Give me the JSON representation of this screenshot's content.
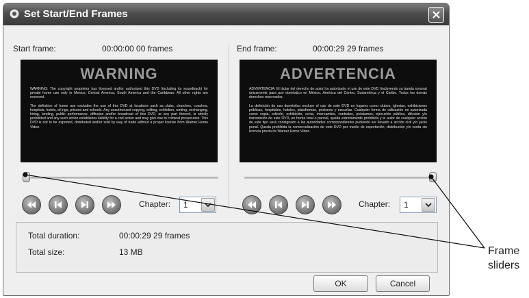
{
  "window": {
    "title": "Set Start/End Frames"
  },
  "start": {
    "label": "Start frame:",
    "value": "00:00:00 00 frames",
    "preview_heading": "WARNING",
    "preview_text_1": "WARNING: The copyright proprietor has licensed and/or authorized this DVD (including its soundtrack) for private home use only in Mexico, Central America, South America and the Caribbean. All other rights are reserved.",
    "preview_text_2": "The definition of home use excludes the use of this DVD at locations such as clubs, churches, coaches, hospitals, hotels, oil rigs, prisons and schools. Any unauthorized copying, editing, exhibition, renting, exchanging, hiring, lending, public performance, diffusion and/or broadcast of this DVD, or any part thereof, is strictly prohibited and any such action establishes liability for a civil action and may give rise to criminal prosecution. This DVD is not to be exported, distributed and/or sold by way of trade without a proper license from Warner Home Video.",
    "slider_position": 0,
    "chapter_label": "Chapter:",
    "chapter_value": "1"
  },
  "end": {
    "label": "End frame:",
    "value": "00:00:29 29 frames",
    "preview_heading": "ADVERTENCIA",
    "preview_text_1": "ADVERTENCIA: El titular del derecho de autor ha autorizado el uso de este DVD (incluyendo su banda sonora) únicamente para uso doméstico en México, América del Centro, Sudamérica y el Caribe. Todos los demás derechos reservados.",
    "preview_text_2": "La definición de uso doméstico excluye el uso de este DVD en lugares como clubes, iglesias, exhibiciones públicas, hospitales, hoteles, plataformas, prisiones y escuelas. Cualquier forma de utilización no autorizada como copia, edición, exhibición, renta, intercambio, contratos, préstamos, ejecución pública, difusión y/o transmisión de este DVD, en forma total o parcial, queda estrictamente prohibida y el autor de cualquier acción de este tipo será consignado a las autoridades correspondientes pudiendo ser llevado a acción civil y/o juicio penal. Queda prohibida la comercialización de este DVD por medio de exportación, distribución y/o venta sin licencia previa de Warner Home Video.",
    "slider_position": 1,
    "chapter_label": "Chapter:",
    "chapter_value": "1"
  },
  "info": {
    "duration_label": "Total duration:",
    "duration_value": "00:00:29 29 frames",
    "size_label": "Total size:",
    "size_value": "13 MB"
  },
  "buttons": {
    "ok": "OK",
    "cancel": "Cancel"
  },
  "annotation": {
    "line1": "Frame",
    "line2": "sliders"
  },
  "icons": [
    "title-app-icon",
    "close-icon",
    "rewind-icon",
    "step-back-icon",
    "step-forward-icon",
    "fast-forward-icon",
    "chevron-down-icon"
  ]
}
